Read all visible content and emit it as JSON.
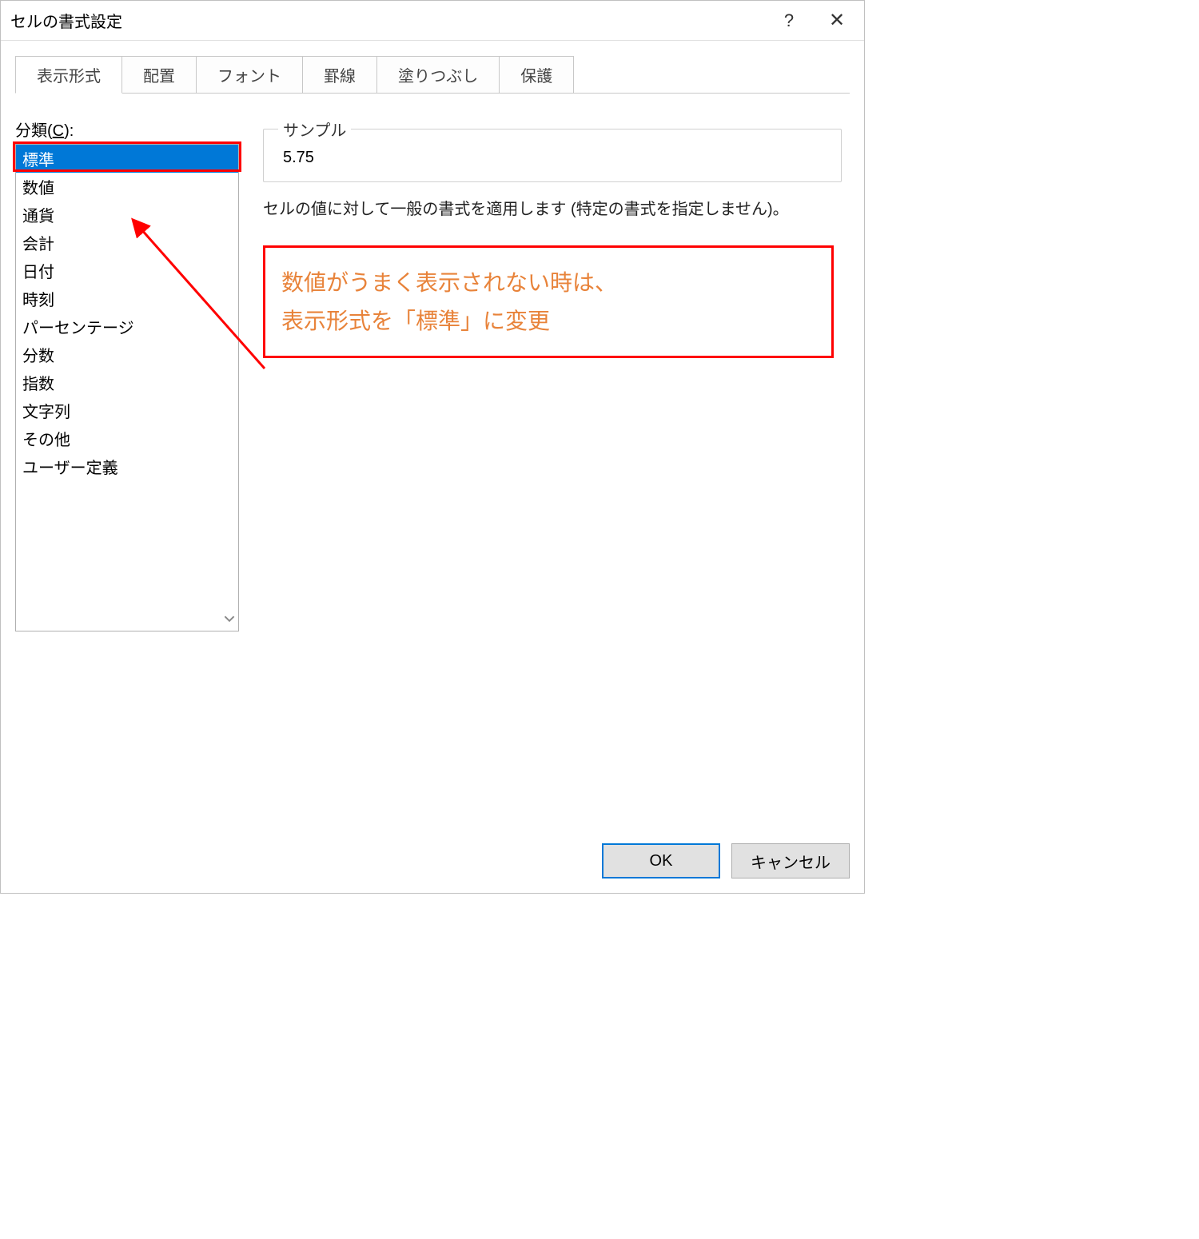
{
  "dialog": {
    "title": "セルの書式設定"
  },
  "tabs": {
    "items": [
      "表示形式",
      "配置",
      "フォント",
      "罫線",
      "塗りつぶし",
      "保護"
    ],
    "active_index": 0
  },
  "category": {
    "label_prefix": "分類(",
    "label_u": "C",
    "label_suffix": "):",
    "items": [
      "標準",
      "数値",
      "通貨",
      "会計",
      "日付",
      "時刻",
      "パーセンテージ",
      "分数",
      "指数",
      "文字列",
      "その他",
      "ユーザー定義"
    ],
    "selected_index": 0
  },
  "sample": {
    "legend": "サンプル",
    "value": "5.75"
  },
  "description": "セルの値に対して一般の書式を適用します (特定の書式を指定しません)。",
  "callout": {
    "line1": "数値がうまく表示されない時は、",
    "line2": "表示形式を「標準」に変更"
  },
  "buttons": {
    "ok": "OK",
    "cancel": "キャンセル"
  }
}
